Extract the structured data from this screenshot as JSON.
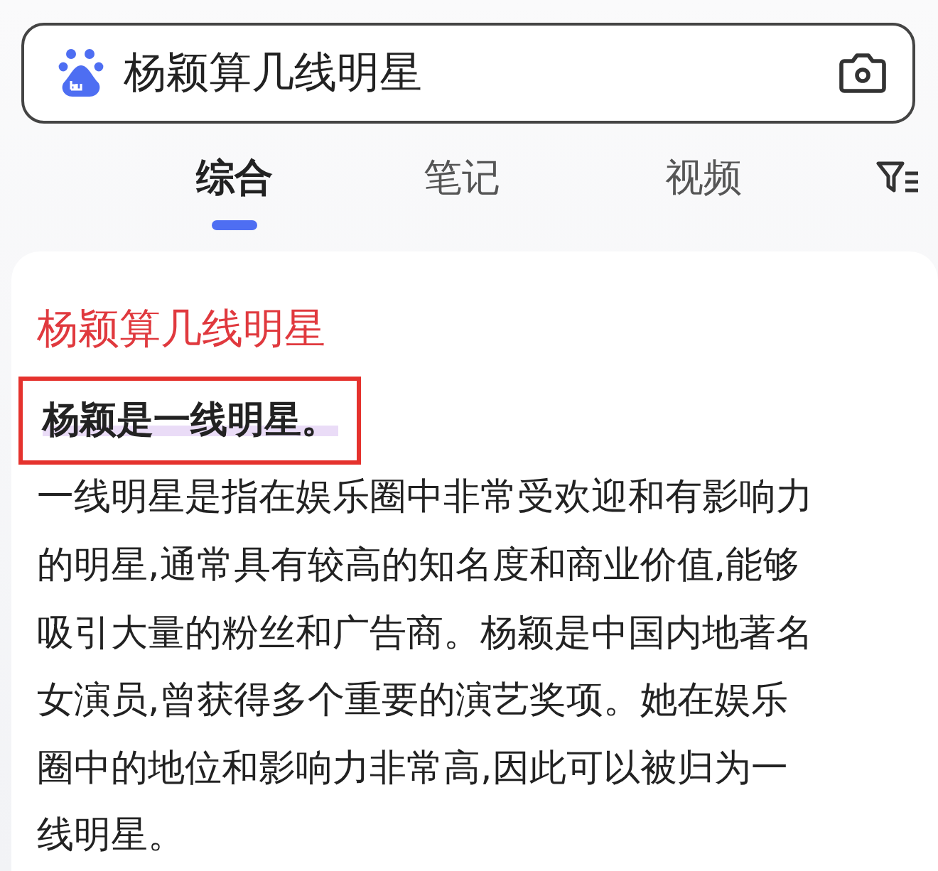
{
  "search": {
    "value": "杨颖算几线明星"
  },
  "tabs": [
    {
      "label": "综合",
      "selected": true
    },
    {
      "label": "笔记",
      "selected": false
    },
    {
      "label": "视频",
      "selected": false
    }
  ],
  "result": {
    "title": "杨颖算几线明星",
    "answer": "杨颖是一线明星。",
    "answer_framed": true,
    "body_lines": [
      "一线明星是指在娱乐圈中非常受欢迎和有影响力",
      "的明星,通常具有较高的知名度和商业价值,能够",
      "吸引大量的粉丝和广告商。杨颖是中国内地著名",
      "女演员,曾获得多个重要的演艺奖项。她在娱乐",
      "圈中的地位和影响力非常高,因此可以被归为一",
      "线明星。"
    ]
  }
}
